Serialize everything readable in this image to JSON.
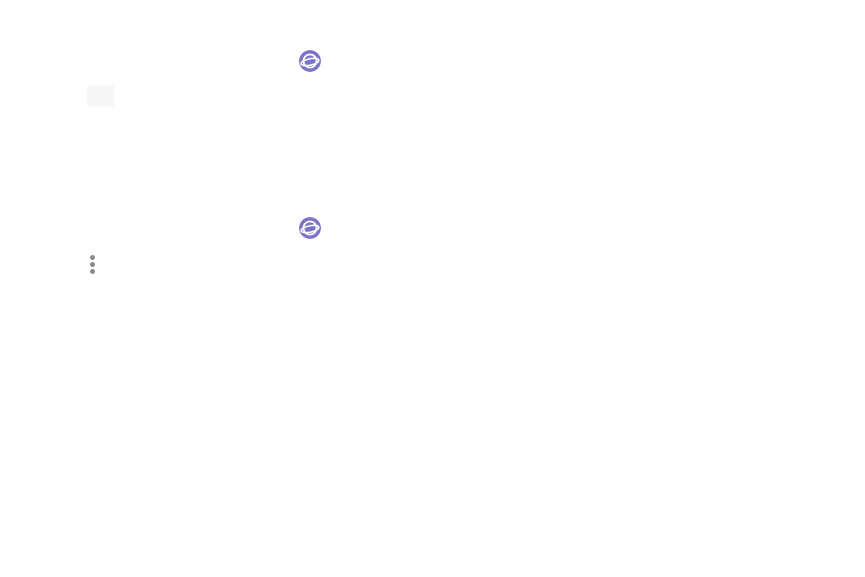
{
  "icons": {
    "browser_icon_primary": "samsung-internet-icon",
    "tabs_icon": "tabs-icon",
    "more_options_icon": "more-options-icon"
  },
  "colors": {
    "browser_icon_bg": "#7d74c8",
    "more_dots": "#8a8a8a",
    "tabs_box": "#f7f7f7",
    "background": "#ffffff"
  }
}
